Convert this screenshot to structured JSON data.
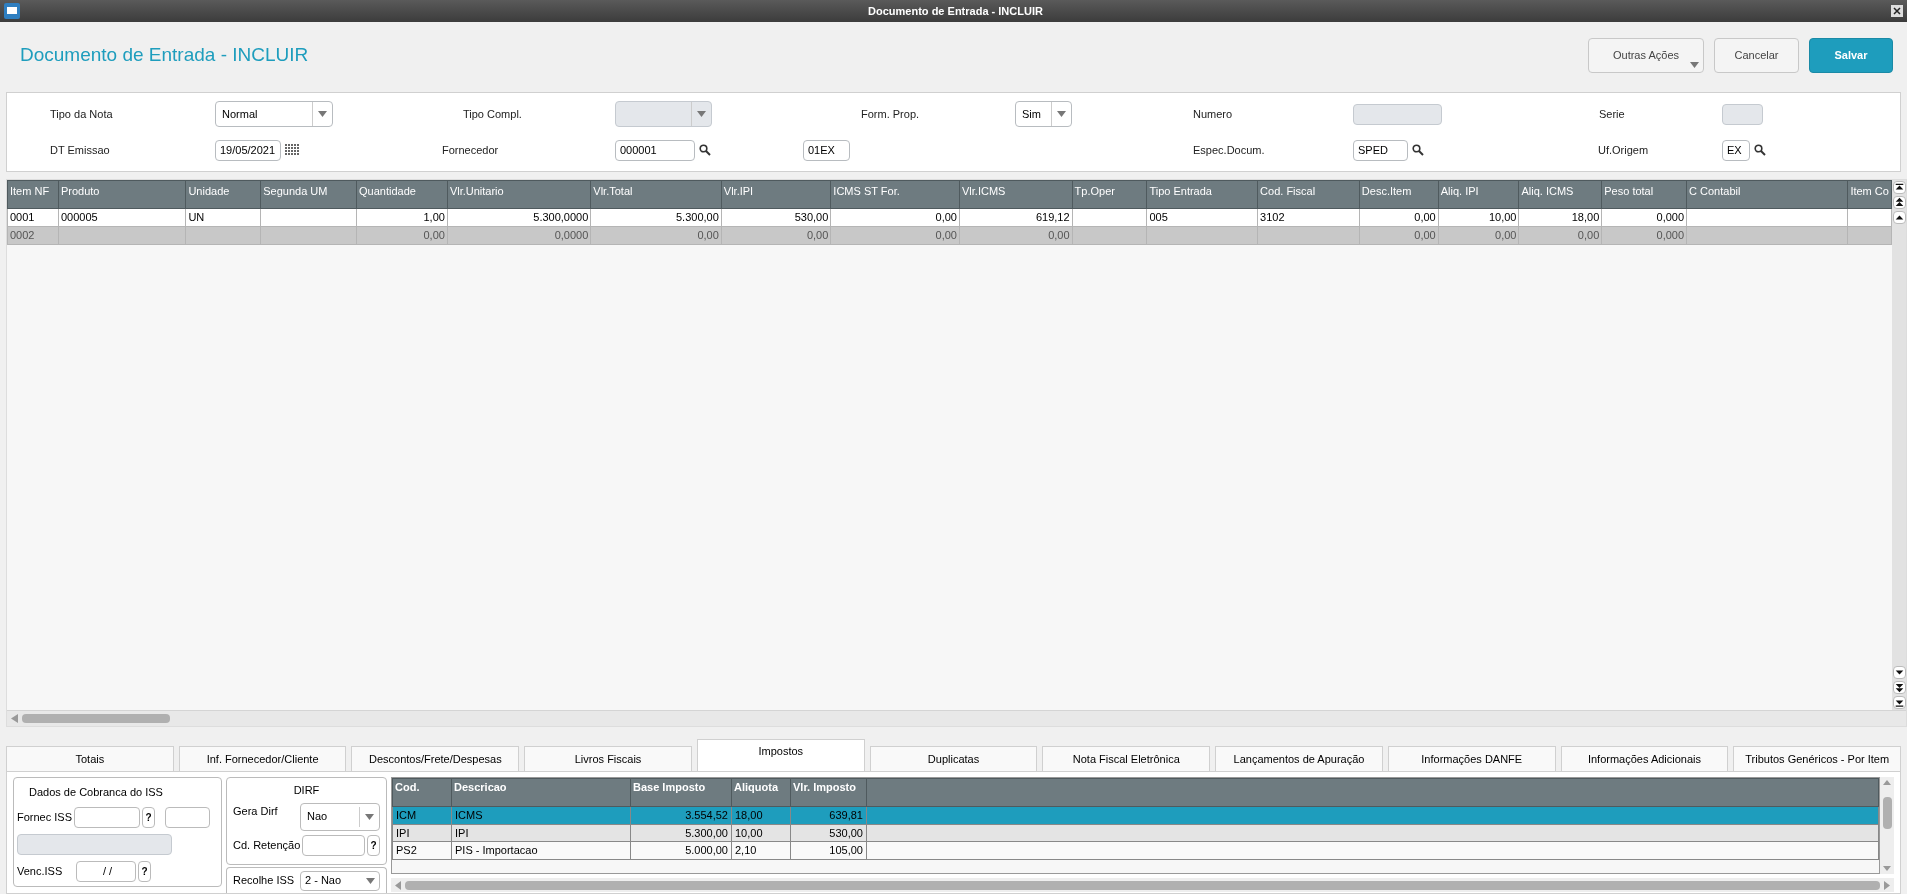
{
  "window": {
    "title": "Documento de Entrada - INCLUIR"
  },
  "header": {
    "title": "Documento de Entrada - INCLUIR",
    "buttons": [
      {
        "label": "Outras Ações",
        "kind": "menu"
      },
      {
        "label": "Cancelar",
        "kind": "secondary"
      },
      {
        "label": "Salvar",
        "kind": "primary"
      }
    ]
  },
  "form": {
    "fields": [
      {
        "label": "Tipo da Nota",
        "kind": "select",
        "value": "Normal",
        "disabled": false
      },
      {
        "label": "Tipo Compl.",
        "kind": "select",
        "disabled": true
      },
      {
        "label": "Form. Prop.",
        "kind": "select",
        "value": "Sim",
        "disabled": false
      },
      {
        "label": "Numero",
        "kind": "input",
        "disabled": true
      },
      {
        "label": "Serie",
        "kind": "input",
        "disabled": true
      },
      {
        "label": "DT Emissao",
        "kind": "date",
        "value": "19/05/2021",
        "disabled": false
      },
      {
        "label": "Fornecedor",
        "kind": "lookup",
        "value": "000001",
        "extra": "01EX",
        "disabled": false
      },
      {
        "label": "Espec.Docum.",
        "kind": "lookup",
        "value": "SPED",
        "disabled": false
      },
      {
        "label": "Uf.Origem",
        "kind": "lookup",
        "value": "EX",
        "disabled": false
      }
    ]
  },
  "grid": {
    "columns": [
      "Item NF",
      "Produto",
      "Unidade",
      "Segunda UM",
      "Quantidade",
      "Vlr.Unitario",
      "Vlr.Total",
      "Vlr.IPI",
      "ICMS ST For.",
      "Vlr.ICMS",
      "Tp.Oper",
      "Tipo Entrada",
      "Cod. Fiscal",
      "Desc.Item",
      "Aliq. IPI",
      "Aliq. ICMS",
      "Peso total",
      "C Contabil",
      "Item Co"
    ],
    "rows": [
      {
        "disabled": false,
        "cells": [
          "0001",
          "000005",
          "UN",
          "",
          "1,00",
          "5.300,0000",
          "5.300,00",
          "530,00",
          "0,00",
          "619,12",
          "",
          "005",
          "3102",
          "0,00",
          "10,00",
          "18,00",
          "0,000",
          "",
          ""
        ]
      },
      {
        "disabled": true,
        "cells": [
          "0002",
          "",
          "",
          "",
          "0,00",
          "0,0000",
          "0,00",
          "0,00",
          "0,00",
          "0,00",
          "",
          "",
          "",
          "0,00",
          "0,00",
          "0,00",
          "0,000",
          "",
          ""
        ]
      }
    ]
  },
  "tabs": [
    {
      "label": "Totais",
      "selected": false
    },
    {
      "label": "Inf. Fornecedor/Cliente",
      "selected": false
    },
    {
      "label": "Descontos/Frete/Despesas",
      "selected": false
    },
    {
      "label": "Livros Fiscais",
      "selected": false
    },
    {
      "label": "Impostos",
      "selected": true
    },
    {
      "label": "Duplicatas",
      "selected": false
    },
    {
      "label": "Nota Fiscal Eletrônica",
      "selected": false
    },
    {
      "label": "Lançamentos de Apuração",
      "selected": false
    },
    {
      "label": "Informações DANFE",
      "selected": false
    },
    {
      "label": "Informações Adicionais",
      "selected": false
    },
    {
      "label": "Tributos Genéricos - Por Item",
      "selected": false
    }
  ],
  "iss": {
    "title": "Dados de Cobranca do ISS",
    "fornec_label": "Fornec ISS",
    "fornec_help": "?",
    "venc_label": "Venc.ISS",
    "venc_value": " / /",
    "venc_help": "?"
  },
  "dirf": {
    "title": "DIRF",
    "gera_label": "Gera Dirf",
    "gera_value": "Nao",
    "retencao_label": "Cd. Retenção",
    "retencao_help": "?",
    "recolhe_label": "Recolhe ISS",
    "recolhe_value": "2 - Nao"
  },
  "taxes": {
    "columns": [
      "Cod.",
      "Descricao",
      "Base Imposto",
      "Aliquota",
      "Vlr. Imposto"
    ],
    "rows": [
      {
        "selected": true,
        "cells": [
          "ICM",
          "ICMS",
          "3.554,52",
          "18,00",
          "639,81"
        ]
      },
      {
        "selected": false,
        "cells": [
          "IPI",
          "IPI",
          "5.300,00",
          "10,00",
          "530,00"
        ]
      },
      {
        "selected": false,
        "cells": [
          "PS2",
          "PIS - Importacao",
          "5.000,00",
          "2,10",
          "105,00"
        ]
      }
    ]
  }
}
